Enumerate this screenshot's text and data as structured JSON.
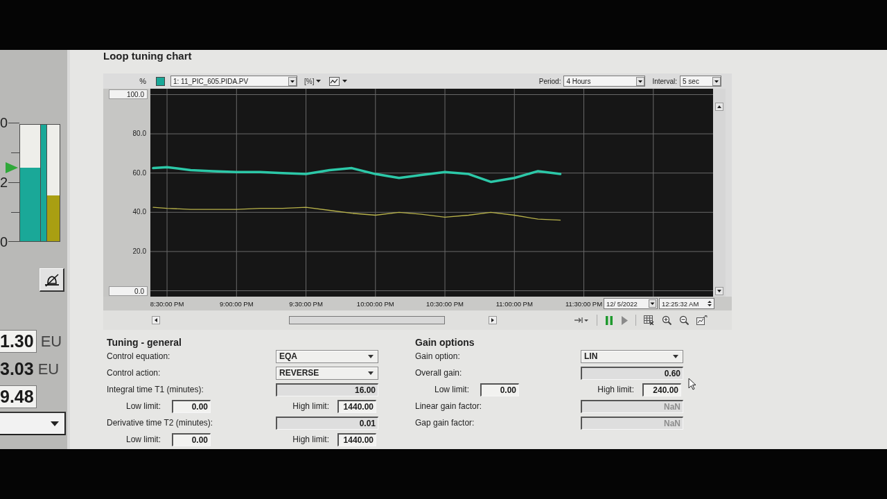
{
  "left_panel": {
    "scale_labels": [
      "0",
      "2",
      "0"
    ],
    "bars": [
      {
        "level": 0.63,
        "color": "#1aa898"
      },
      {
        "level": 0.39,
        "color": "#a99f12"
      }
    ],
    "setpoint_marker": {
      "level": 0.62
    },
    "readings": [
      {
        "kind": "field",
        "value": "1.30",
        "unit": "EU"
      },
      {
        "kind": "text",
        "value": "3.03",
        "unit": "EU"
      },
      {
        "kind": "field",
        "value": "9.48"
      }
    ]
  },
  "title": "Loop tuning chart",
  "chart": {
    "axis_unit": "%",
    "trace": {
      "label": "1: 11_PIC_605.PIDA.PV",
      "color": "#1aa898"
    },
    "unit_menu": "[%]",
    "period": {
      "label": "Period:",
      "value": "4 Hours"
    },
    "interval": {
      "label": "Interval:",
      "value": "5 sec"
    },
    "date": "12/ 5/2022",
    "time": "12:25:32 AM",
    "chart_data": [
      {
        "type": "line",
        "x": [
          20.4,
          20.5,
          20.67,
          20.83,
          21,
          21.17,
          21.33,
          21.5,
          21.67,
          21.83,
          22,
          22.17,
          22.33,
          22.5,
          22.67,
          22.83,
          23,
          23.17,
          23.33
        ],
        "series": [
          {
            "color": "#2cc8a8",
            "values": [
              62.5,
              63,
              61.5,
              61,
              60.5,
              60.5,
              60,
              59.5,
              61.5,
              62.5,
              59.5,
              57.5,
              59,
              60.5,
              59.5,
              55.5,
              57.5,
              61,
              59.5
            ]
          },
          {
            "color": "#b9b34a",
            "values": [
              42.5,
              42,
              41.5,
              41.5,
              41.5,
              42,
              42,
              42.5,
              41,
              39.5,
              38.5,
              40,
              39,
              37.5,
              38.5,
              40,
              38.5,
              36.5,
              36
            ]
          }
        ],
        "xlim": [
          20.38,
          24.43
        ],
        "ylim": [
          -3,
          103
        ],
        "xticks": [
          {
            "value": 20.5,
            "label": "8:30:00 PM"
          },
          {
            "value": 21,
            "label": "9:00:00 PM"
          },
          {
            "value": 21.5,
            "label": "9:30:00 PM"
          },
          {
            "value": 22,
            "label": "10:00:00 PM"
          },
          {
            "value": 22.5,
            "label": "10:30:00 PM"
          },
          {
            "value": 23,
            "label": "11:00:00 PM"
          },
          {
            "value": 23.5,
            "label": "11:30:00 PM"
          }
        ],
        "yticks": [
          {
            "value": 0,
            "label": "0.0"
          },
          {
            "value": 20,
            "label": "20.0"
          },
          {
            "value": 40,
            "label": "40.0"
          },
          {
            "value": 60,
            "label": "60.0"
          },
          {
            "value": 80,
            "label": "80.0"
          },
          {
            "value": 100,
            "label": "100.0"
          }
        ],
        "grid": true
      }
    ]
  },
  "tuning_general": {
    "title": "Tuning - general",
    "rows": [
      {
        "kind": "dropdown",
        "label": "Control equation:",
        "value": "EQA"
      },
      {
        "kind": "dropdown",
        "label": "Control action:",
        "value": "REVERSE"
      },
      {
        "kind": "number",
        "label": "Integral time T1 (minutes):",
        "value": "16.00",
        "disabled": false
      },
      {
        "kind": "limits",
        "low_label": "Low limit:",
        "low": "0.00",
        "high_label": "High limit:",
        "high": "1440.00"
      },
      {
        "kind": "number",
        "label": "Derivative time T2 (minutes):",
        "value": "0.01",
        "disabled": false
      },
      {
        "kind": "limits",
        "low_label": "Low limit:",
        "low": "0.00",
        "high_label": "High limit:",
        "high": "1440.00"
      }
    ]
  },
  "gain_options": {
    "title": "Gain options",
    "rows": [
      {
        "kind": "dropdown",
        "label": "Gain option:",
        "value": "LIN"
      },
      {
        "kind": "number",
        "label": "Overall gain:",
        "value": "0.60",
        "disabled": false
      },
      {
        "kind": "limits",
        "low_label": "Low limit:",
        "low": "0.00",
        "high_label": "High limit:",
        "high": "240.00"
      },
      {
        "kind": "number",
        "label": "Linear gain factor:",
        "value": "NaN",
        "disabled": true
      },
      {
        "kind": "number",
        "label": "Gap gain factor:",
        "value": "NaN",
        "disabled": true
      }
    ]
  }
}
